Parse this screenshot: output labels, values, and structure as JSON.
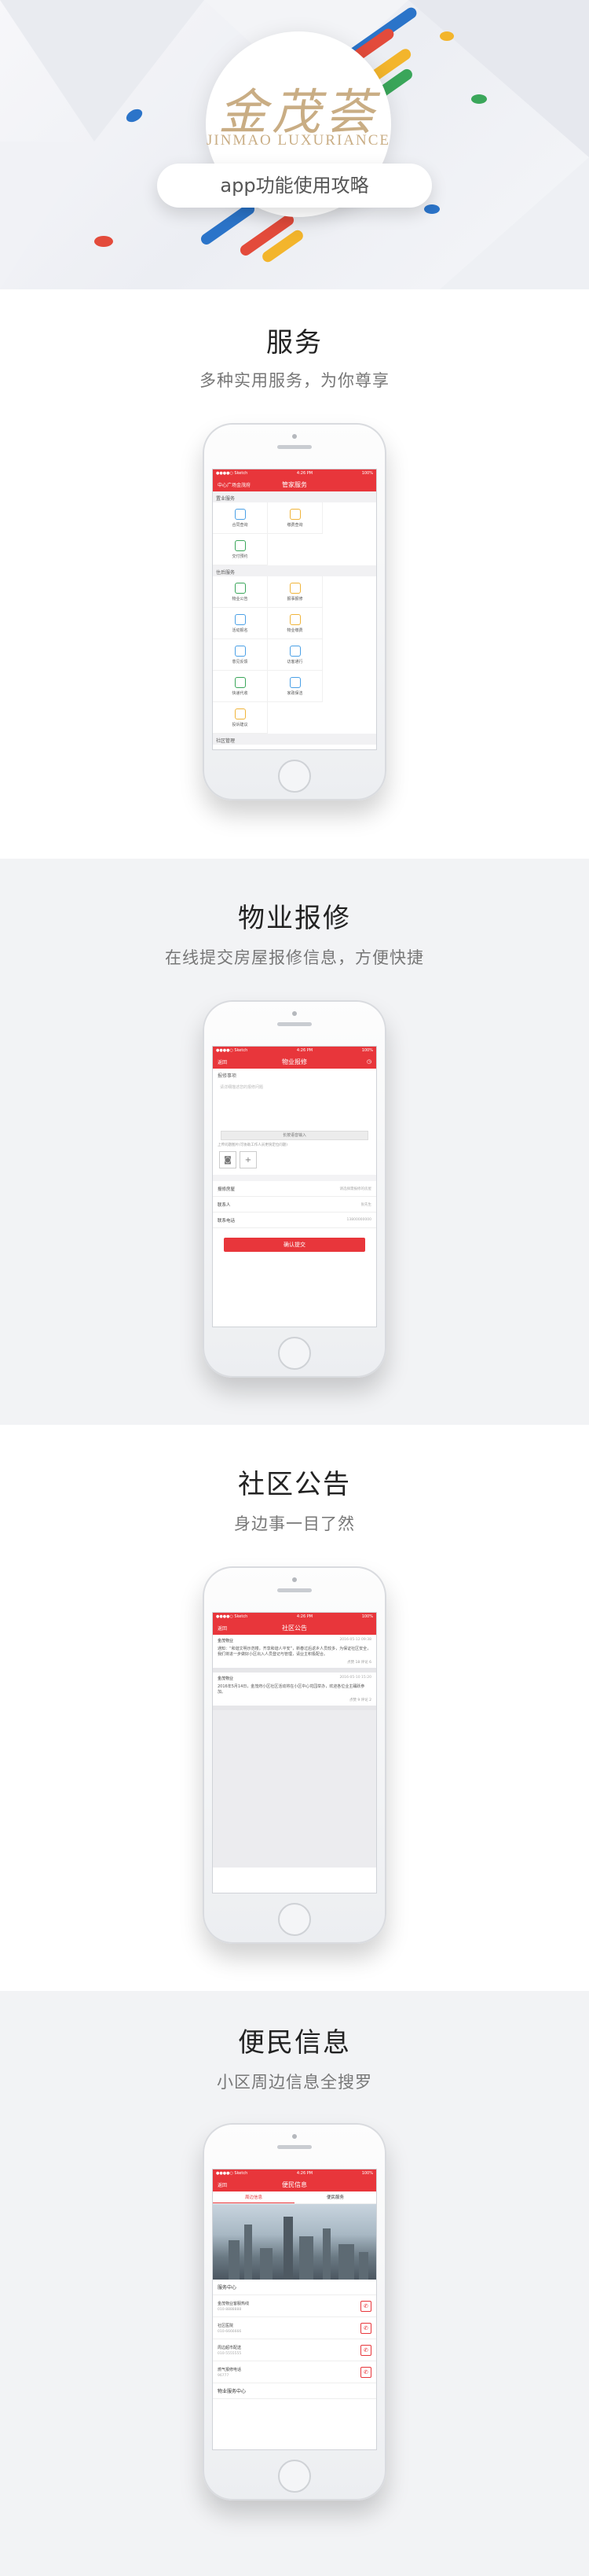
{
  "hero": {
    "brand_cn": "金茂荟",
    "brand_en": "JINMAO LUXURIANCE",
    "subtitle": "app功能使用攻略"
  },
  "sections": [
    {
      "title": "服务",
      "subtitle": "多种实用服务，为你尊享"
    },
    {
      "title": "物业报修",
      "subtitle": "在线提交房屋报修信息，方便快捷"
    },
    {
      "title": "社区公告",
      "subtitle": "身边事一目了然"
    },
    {
      "title": "便民信息",
      "subtitle": "小区周边信息全搜罗"
    }
  ],
  "services_screen": {
    "status_left": "●●●●○ Sketch",
    "status_time": "4:26 PM",
    "status_right": "100%",
    "nav_left": "中心广场金茂府",
    "nav_title": "管家服务",
    "groups": [
      {
        "title": "置业服务",
        "items": [
          "合同查询",
          "缴费查询",
          "交付预约"
        ]
      },
      {
        "title": "住后服务",
        "items": [
          "物业公告",
          "报事报修",
          "活动报名",
          "物业缴费",
          "意见反馈",
          "访客通行",
          "快递代收",
          "家政保洁",
          "投诉建议"
        ]
      },
      {
        "title": "社区管理",
        "items": []
      }
    ]
  },
  "repair_screen": {
    "status_left": "●●●●○ Sketch",
    "status_time": "4:26 PM",
    "status_right": "100%",
    "back": "返回",
    "nav_title": "物业报修",
    "section_label": "报修事项",
    "placeholder": "请详细描述您的报修问题",
    "voice_button": "长按语音输入",
    "photo_hint": "上传问题图片(可协助工作人员更快定位问题)",
    "rows": [
      {
        "label": "报修房屋",
        "value": "请选择需报修的房屋"
      },
      {
        "label": "联系人",
        "value": "张先生"
      },
      {
        "label": "联系电话",
        "value": "13800000000"
      }
    ],
    "submit": "确认提交"
  },
  "notice_screen": {
    "status_left": "●●●●○ Sketch",
    "status_time": "4:26 PM",
    "status_right": "100%",
    "back": "返回",
    "nav_title": "社区公告",
    "notices": [
      {
        "source": "金茂物业",
        "date": "2016-05-12 09:38",
        "body": "通知：“和谐文明示范楼，齐享和谐人平安”，新春过后返乡人员较多，为保证社区安全，我们将进一步做好小区出入人员登记与管理，请业主积极配合。",
        "footer": "点赞 18  评论 6"
      },
      {
        "source": "金茂物业",
        "date": "2016-05-10 15:20",
        "body": "2016年5月14日，金茂府小区社区活动将在小区中心花园举办，欢迎各位业主踊跃参加。",
        "footer": "点赞 9  评论 2"
      }
    ]
  },
  "info_screen": {
    "status_left": "●●●●○ Sketch",
    "status_time": "4:26 PM",
    "status_right": "100%",
    "back": "返回",
    "nav_title": "便民信息",
    "tabs": [
      "周边信息",
      "便民服务"
    ],
    "list_header": "服务中心",
    "rows": [
      {
        "title": "金茂物业客服热线",
        "sub": "010-8888888"
      },
      {
        "title": "社区医院",
        "sub": "010-6666666"
      },
      {
        "title": "周边超市配送",
        "sub": "010-5555555"
      },
      {
        "title": "燃气报修电话",
        "sub": "96777"
      }
    ],
    "footer": "物业服务中心"
  }
}
